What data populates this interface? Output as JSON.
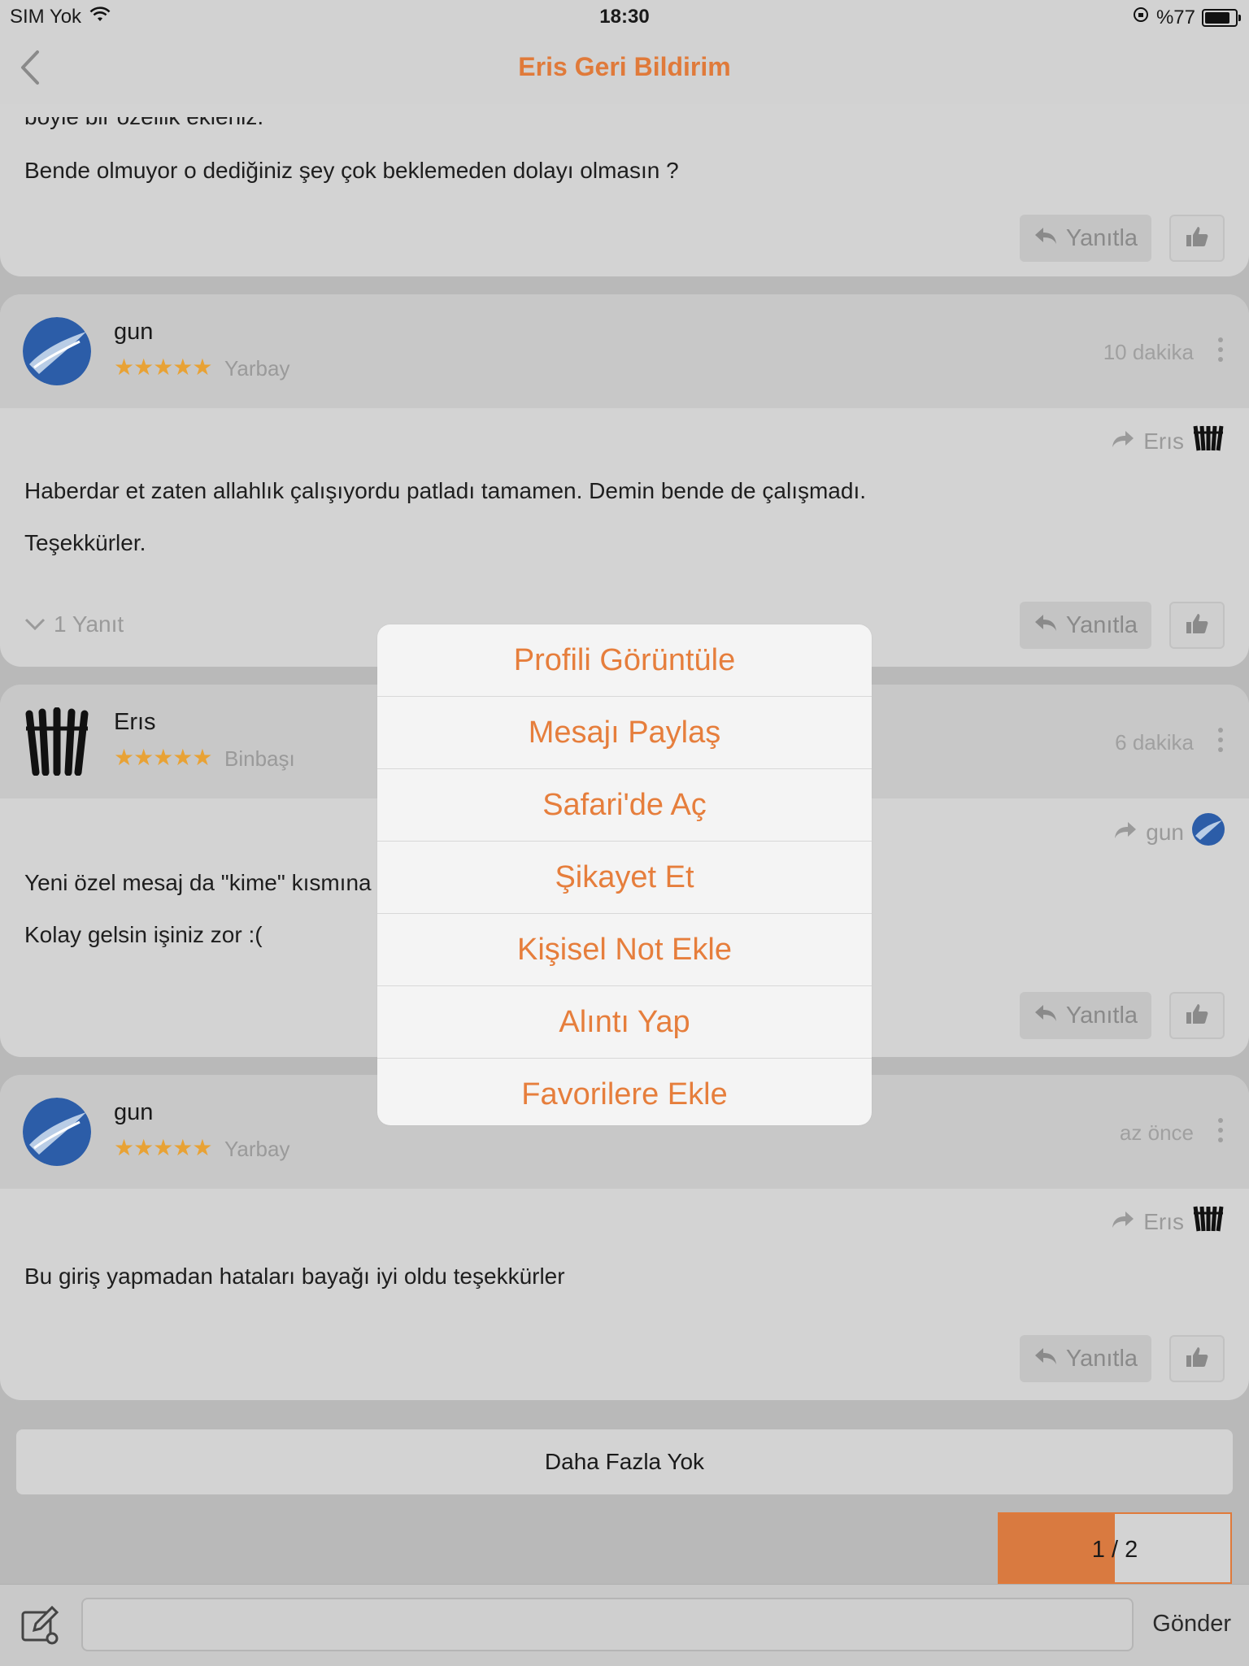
{
  "status": {
    "carrier": "SIM Yok",
    "time": "18:30",
    "battery": "%77"
  },
  "nav": {
    "title": "Eris Geri Bildirim"
  },
  "top_post": {
    "text_cut": "böyle bir özellik ekleniz.",
    "text": "Bende olmuyor o dediğiniz şey çok beklemeden dolayı olmasın ?",
    "reply_label": "Yanıtla"
  },
  "posts": [
    {
      "username": "gun",
      "stars": "★★★★★",
      "rank": "Yarbay",
      "time": "10 dakika",
      "reply_to": "Erıs",
      "paragraphs": [
        "Haberdar et zaten allahlık çalışıyordu patladı tamamen. Demin bende de çalışmadı.",
        "Teşekkürler."
      ],
      "replies": "1 Yanıt",
      "reply_label": "Yanıtla"
    },
    {
      "username": "Erıs",
      "stars": "★★★★★",
      "rank": "Binbaşı",
      "time": "6 dakika",
      "reply_to": "gun",
      "paragraphs": [
        "Yeni özel mesaj da \"kime\" kısmına",
        "Kolay gelsin işiniz zor :("
      ],
      "reply_label": "Yanıtla"
    },
    {
      "username": "gun",
      "stars": "★★★★★",
      "rank": "Yarbay",
      "time": "az önce",
      "reply_to": "Erıs",
      "paragraphs": [
        "Bu giriş yapmadan hataları bayağı iyi oldu teşekkürler"
      ],
      "reply_label": "Yanıtla"
    }
  ],
  "no_more": "Daha Fazla Yok",
  "pager": {
    "label": "1 / 2",
    "progress": 0.5
  },
  "bottom": {
    "send": "Gönder",
    "input_value": ""
  },
  "menu": {
    "items": [
      "Profili Görüntüle",
      "Mesajı Paylaş",
      "Safari'de Aç",
      "Şikayet Et",
      "Kişisel Not Ekle",
      "Alıntı Yap",
      "Favorilere Ekle"
    ]
  },
  "colors": {
    "accent": "#e07a3a",
    "star": "#e8a235"
  }
}
